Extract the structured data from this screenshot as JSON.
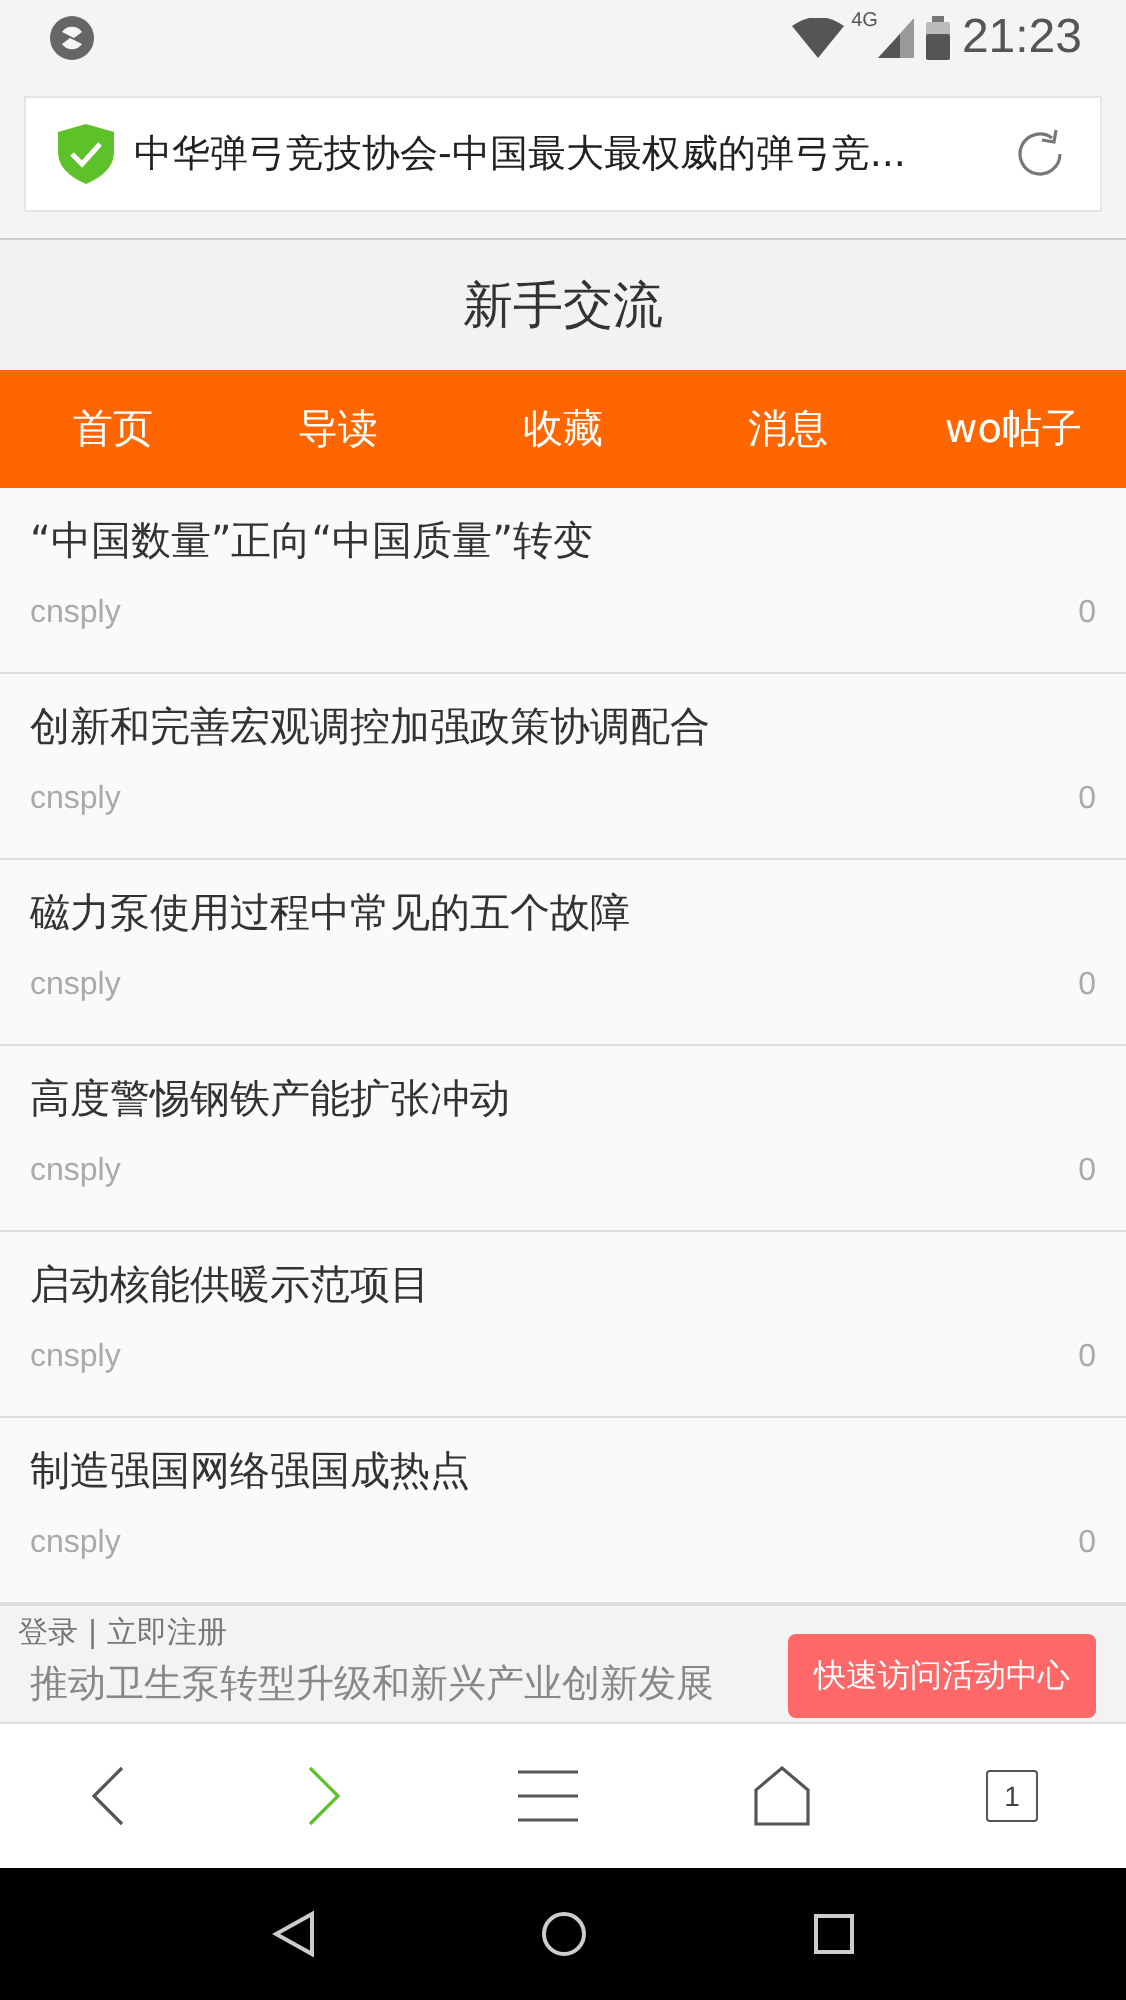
{
  "status_bar": {
    "network": "4G",
    "time": "21:23"
  },
  "address_bar": {
    "title": "中华弹弓竞技协会-中国最大最权威的弹弓竞..."
  },
  "page_title": "新手交流",
  "nav": [
    {
      "label": "首页"
    },
    {
      "label": "导读"
    },
    {
      "label": "收藏"
    },
    {
      "label": "消息"
    },
    {
      "label": "wo帖子"
    }
  ],
  "posts": [
    {
      "title": "“中国数量”正向“中国质量”转变",
      "author": "cnsply",
      "count": "0"
    },
    {
      "title": "创新和完善宏观调控加强政策协调配合",
      "author": "cnsply",
      "count": "0"
    },
    {
      "title": "磁力泵使用过程中常见的五个故障",
      "author": "cnsply",
      "count": "0"
    },
    {
      "title": "高度警惕钢铁产能扩张冲动",
      "author": "cnsply",
      "count": "0"
    },
    {
      "title": "启动核能供暖示范项目",
      "author": "cnsply",
      "count": "0"
    },
    {
      "title": "制造强国网络强国成热点",
      "author": "cnsply",
      "count": "0"
    },
    {
      "title": "推动卫生泵转型升级和新兴产业创新发展"
    }
  ],
  "footer": {
    "login": "登录",
    "separator": "|",
    "register": "立即注册",
    "activity_button": "快速访问活动中心"
  },
  "toolbar": {
    "tab_count": "1"
  }
}
